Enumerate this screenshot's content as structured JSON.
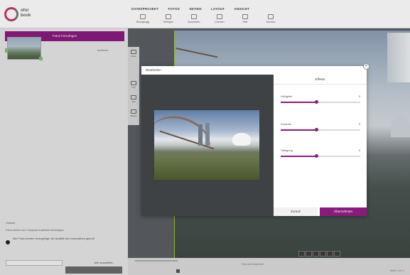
{
  "header": {
    "logo_text": "ofur\nbook",
    "menu": [
      "DATEI/PROJEKT",
      "FOTOS",
      "SEITEN",
      "LAYOUT",
      "ANSICHT"
    ],
    "tools": [
      "Rückgängig",
      "Einfügen",
      "Bearbeiten",
      "Löschen",
      "Hilfe",
      "Drucken"
    ]
  },
  "left_panel": {
    "add_button": "Fotos hinzufügen",
    "sort_label": "sortieren",
    "note_label": "Hinweis",
    "note_text": "Fotos direkt vom Computer/Laufwerk hinzufügen",
    "select_text": "Alle Fotos werden hinzugefügt, die Qualität wird automatisch geprüft",
    "footer_btn": "Alle auswählen"
  },
  "side_tabs": [
    "Fotos",
    "Clip",
    "Text",
    "Maske"
  ],
  "modal": {
    "title": "Bearbeiten",
    "close": "×",
    "panel_header": "Effekte",
    "sliders": [
      {
        "label": "Helligkeit",
        "value": "0",
        "level": 0.45
      },
      {
        "label": "Kontrast",
        "value": "0",
        "level": 0.45
      },
      {
        "label": "Sättigung",
        "value": "0",
        "level": 0.45
      }
    ],
    "cancel": "Zurück",
    "apply": "Übernehmen"
  },
  "status": {
    "right_text": "Seite 1 von 1",
    "canvas_info": "Foto wird bearbeitet"
  }
}
